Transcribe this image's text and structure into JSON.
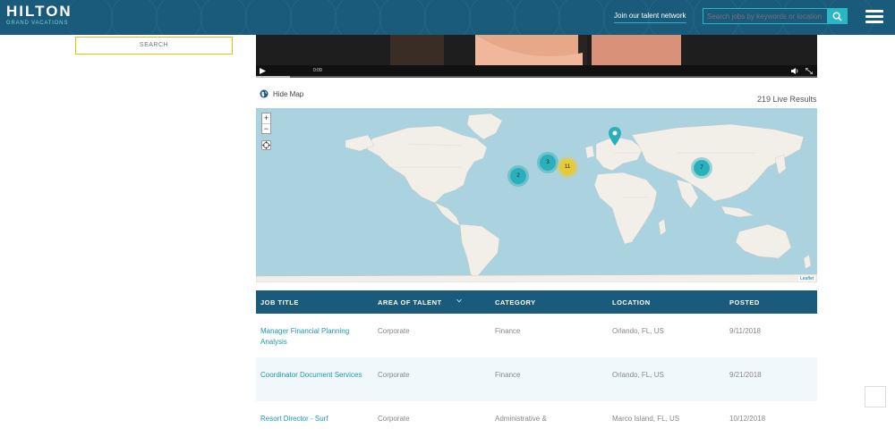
{
  "header": {
    "logo_main": "HILTON",
    "logo_sub": "GRAND VACATIONS",
    "talent_link": "Join our talent network",
    "search_placeholder": "Search jobs by keywords or location",
    "bg_color": "#1a5a7a",
    "accent_color": "#2ab7c5",
    "search_icon": "search-icon",
    "menu_icon": "hamburger-menu-icon"
  },
  "sidebar": {
    "search_button": "SEARCH"
  },
  "video": {
    "time": "0:09",
    "progress_fraction": 0.06
  },
  "map_section": {
    "hide_map_label": "Hide Map",
    "results_label": "219 Live Results",
    "zoom_in": "+",
    "zoom_out": "−",
    "attribution": "Leaflet",
    "clusters": [
      {
        "label": "2",
        "color": "teal",
        "region": "north-pacific"
      },
      {
        "label": "3",
        "color": "teal",
        "region": "north-america"
      },
      {
        "label": "11",
        "color": "yellow",
        "region": "north-america"
      },
      {
        "label": "7",
        "color": "teal",
        "region": "east-asia"
      }
    ],
    "pin": {
      "color": "#2ab0bb",
      "region": "europe"
    }
  },
  "table": {
    "columns": [
      "JOB TITLE",
      "AREA OF TALENT",
      "CATEGORY",
      "LOCATION",
      "POSTED"
    ],
    "rows": [
      {
        "title": "Manager Financial Planning Analysis",
        "area": "Corporate",
        "category": "Finance",
        "location": "Orlando, FL, US",
        "posted": "9/11/2018"
      },
      {
        "title": "Coordinator Document Services",
        "area": "Corporate",
        "category": "Finance",
        "location": "Orlando, FL, US",
        "posted": "9/21/2018"
      },
      {
        "title": "Resort Director - Surf",
        "area": "Corporate",
        "category": "Administrative &",
        "location": "Marco Island, FL, US",
        "posted": "10/12/2018"
      }
    ]
  }
}
